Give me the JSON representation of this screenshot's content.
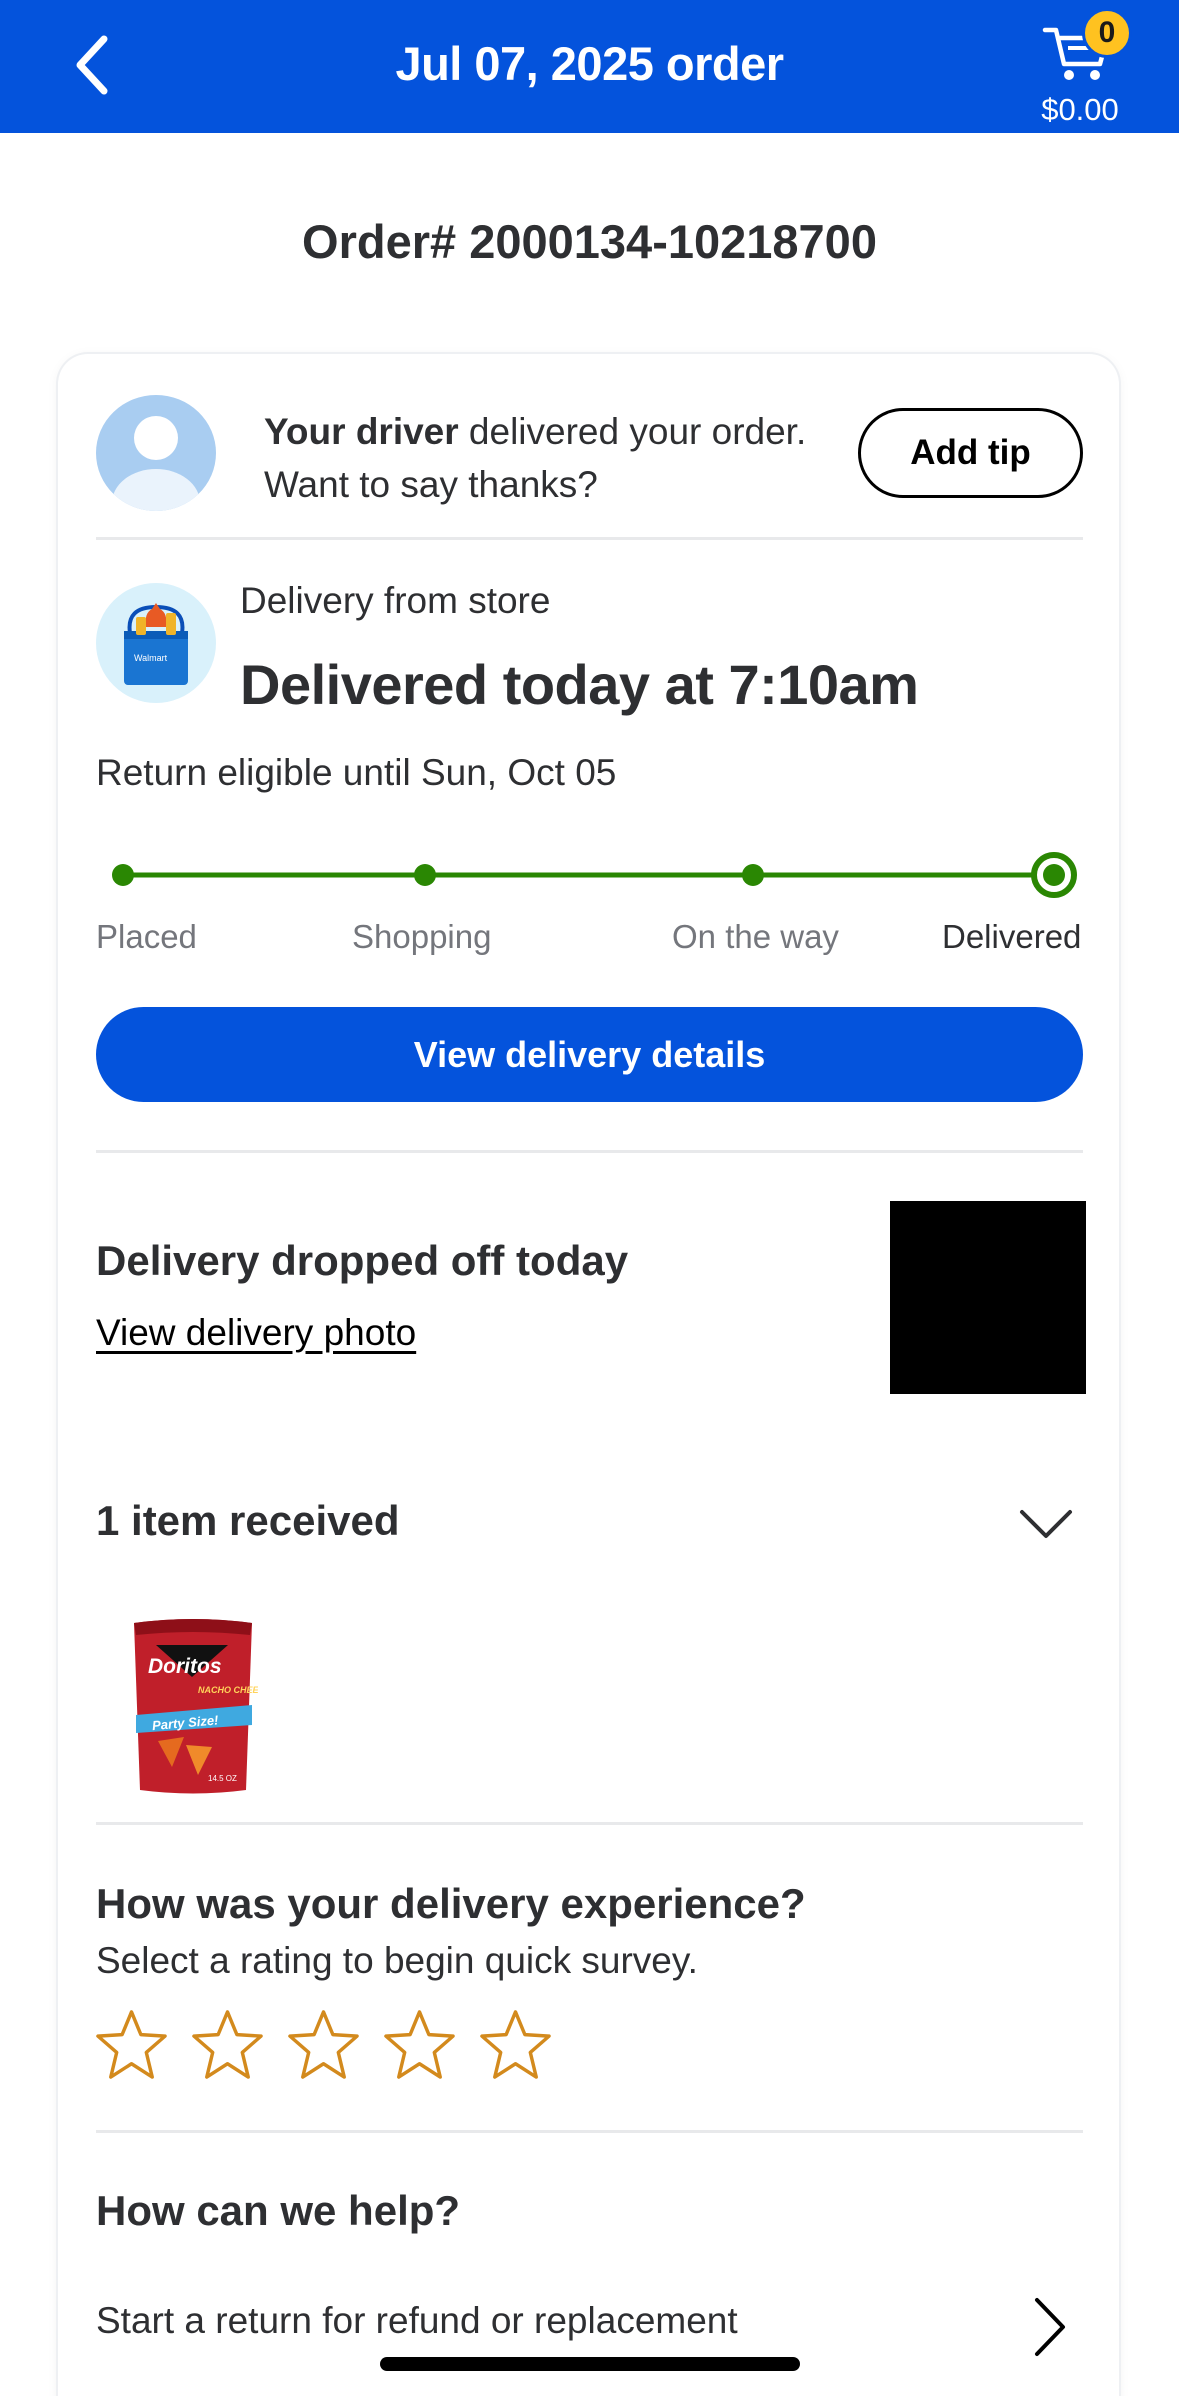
{
  "header": {
    "title": "Jul 07, 2025 order",
    "cart_count": "0",
    "cart_total": "$0.00"
  },
  "order": {
    "number": "Order# 2000134-10218700"
  },
  "driver": {
    "bold": "Your driver",
    "rest": " delivered your order.",
    "line2": "Want to say thanks?",
    "add_tip": "Add tip"
  },
  "delivery": {
    "from": "Delivery from store",
    "status": "Delivered today at 7:10am",
    "return_eligible": "Return eligible until Sun, Oct 05",
    "steps": [
      "Placed",
      "Shopping",
      "On the way",
      "Delivered"
    ],
    "current_step": 4,
    "view_details": "View delivery details",
    "store_logo_text": "Walmart"
  },
  "dropoff": {
    "title": "Delivery dropped off today",
    "photo_link": "View delivery photo"
  },
  "items": {
    "title": "1 item received",
    "product_brand": "Doritos",
    "product_flavor": "NACHO CHEESE",
    "product_banner": "Party Size!",
    "product_size": "14.5 OZ"
  },
  "survey": {
    "title": "How was your delivery experience?",
    "subtitle": "Select a rating to begin quick survey.",
    "star_count": 5
  },
  "help": {
    "title": "How can we help?",
    "return_option": "Start a return for refund or replacement"
  },
  "colors": {
    "brand_blue": "#0453dc",
    "progress_green": "#2a8703",
    "star_gold": "#d38a1d",
    "badge_yellow": "#ffc220"
  }
}
